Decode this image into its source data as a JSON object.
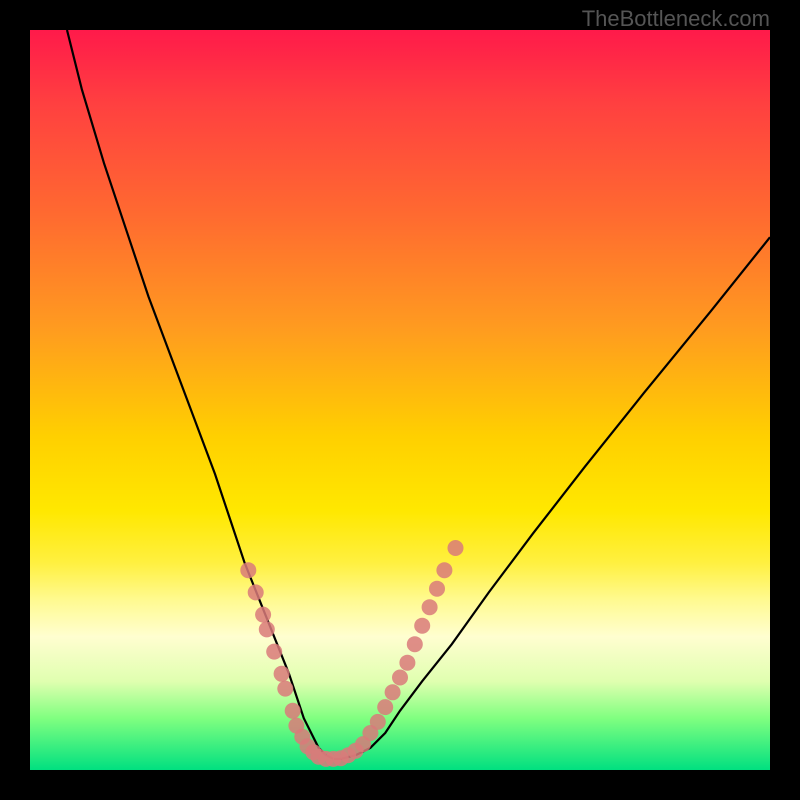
{
  "watermark": "TheBottleneck.com",
  "chart_data": {
    "type": "line",
    "title": "",
    "xlabel": "",
    "ylabel": "",
    "xlim": [
      0,
      100
    ],
    "ylim": [
      0,
      100
    ],
    "series": [
      {
        "name": "bottleneck-curve",
        "x": [
          5,
          7,
          10,
          13,
          16,
          19,
          22,
          25,
          27,
          29,
          31,
          33,
          35,
          36,
          37,
          38,
          39,
          40,
          41,
          42,
          44,
          46,
          48,
          50,
          53,
          57,
          62,
          68,
          75,
          83,
          92,
          100
        ],
        "values": [
          100,
          92,
          82,
          73,
          64,
          56,
          48,
          40,
          34,
          28,
          23,
          18,
          13,
          10,
          7,
          5,
          3,
          2,
          1.5,
          1.5,
          2,
          3,
          5,
          8,
          12,
          17,
          24,
          32,
          41,
          51,
          62,
          72
        ]
      }
    ],
    "markers": {
      "name": "highlighted-points",
      "color": "#d97a7a",
      "points": [
        {
          "x": 29.5,
          "y": 27
        },
        {
          "x": 30.5,
          "y": 24
        },
        {
          "x": 31.5,
          "y": 21
        },
        {
          "x": 32.0,
          "y": 19
        },
        {
          "x": 33.0,
          "y": 16
        },
        {
          "x": 34.0,
          "y": 13
        },
        {
          "x": 34.5,
          "y": 11
        },
        {
          "x": 35.5,
          "y": 8
        },
        {
          "x": 36.0,
          "y": 6
        },
        {
          "x": 36.8,
          "y": 4.5
        },
        {
          "x": 37.5,
          "y": 3.2
        },
        {
          "x": 38.3,
          "y": 2.4
        },
        {
          "x": 39.0,
          "y": 1.8
        },
        {
          "x": 40.0,
          "y": 1.5
        },
        {
          "x": 41.0,
          "y": 1.5
        },
        {
          "x": 42.0,
          "y": 1.6
        },
        {
          "x": 43.0,
          "y": 2.0
        },
        {
          "x": 44.0,
          "y": 2.6
        },
        {
          "x": 45.0,
          "y": 3.5
        },
        {
          "x": 46.0,
          "y": 5
        },
        {
          "x": 47.0,
          "y": 6.5
        },
        {
          "x": 48.0,
          "y": 8.5
        },
        {
          "x": 49.0,
          "y": 10.5
        },
        {
          "x": 50.0,
          "y": 12.5
        },
        {
          "x": 51.0,
          "y": 14.5
        },
        {
          "x": 52.0,
          "y": 17
        },
        {
          "x": 53.0,
          "y": 19.5
        },
        {
          "x": 54.0,
          "y": 22
        },
        {
          "x": 55.0,
          "y": 24.5
        },
        {
          "x": 56.0,
          "y": 27
        },
        {
          "x": 57.5,
          "y": 30
        }
      ]
    }
  }
}
